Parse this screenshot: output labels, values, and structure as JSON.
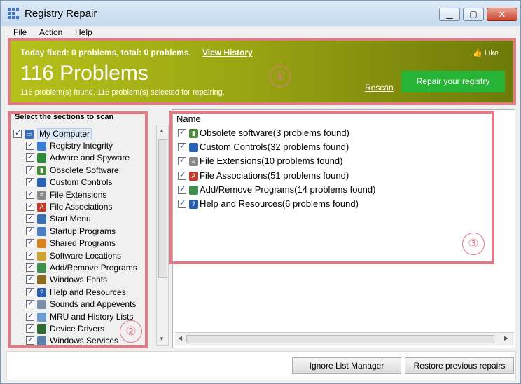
{
  "window": {
    "title": "Registry Repair"
  },
  "menu": [
    "File",
    "Action",
    "Help"
  ],
  "banner": {
    "today": "Today fixed: 0 problems, total: 0 problems.",
    "view_history": "View History",
    "count": "116 Problems",
    "sub": "116 problem(s) found, 116 problem(s) selected for repairing.",
    "rescan": "Rescan",
    "repair": "Repair your registry",
    "like": "Like"
  },
  "annotations": [
    "①",
    "②",
    "③"
  ],
  "sections": {
    "header": "Select the sections to scan",
    "root": "My Computer",
    "items": [
      {
        "label": "Registry Integrity",
        "icon": "registry-icon"
      },
      {
        "label": "Adware and Spyware",
        "icon": "adware-icon"
      },
      {
        "label": "Obsolete Software",
        "icon": "trash-icon"
      },
      {
        "label": "Custom Controls",
        "icon": "controls-icon"
      },
      {
        "label": "File Extensions",
        "icon": "file-icon"
      },
      {
        "label": "File Associations",
        "icon": "file-assoc-icon"
      },
      {
        "label": "Start Menu",
        "icon": "start-menu-icon"
      },
      {
        "label": "Startup Programs",
        "icon": "startup-icon"
      },
      {
        "label": "Shared Programs",
        "icon": "shared-icon"
      },
      {
        "label": "Software Locations",
        "icon": "folder-icon"
      },
      {
        "label": "Add/Remove Programs",
        "icon": "add-remove-icon"
      },
      {
        "label": "Windows Fonts",
        "icon": "fonts-icon"
      },
      {
        "label": "Help and Resources",
        "icon": "help-icon"
      },
      {
        "label": "Sounds and Appevents",
        "icon": "sound-icon"
      },
      {
        "label": "MRU and History Lists",
        "icon": "history-icon"
      },
      {
        "label": "Device Drivers",
        "icon": "driver-icon"
      },
      {
        "label": "Windows Services",
        "icon": "services-icon"
      }
    ]
  },
  "results": {
    "column": "Name",
    "rows": [
      {
        "label": "Obsolete software(3 problems found)",
        "icon": "trash-icon"
      },
      {
        "label": "Custom Controls(32 problems found)",
        "icon": "controls-icon"
      },
      {
        "label": "File Extensions(10 problems found)",
        "icon": "file-icon"
      },
      {
        "label": "File Associations(51 problems found)",
        "icon": "file-assoc-icon"
      },
      {
        "label": "Add/Remove Programs(14 problems found)",
        "icon": "add-remove-icon"
      },
      {
        "label": "Help and Resources(6 problems found)",
        "icon": "help-icon"
      }
    ]
  },
  "buttons": {
    "ignore": "Ignore List Manager",
    "restore": "Restore previous repairs"
  },
  "colors": {
    "banner": "#9aa612",
    "repair": "#27b336",
    "annotation": "#e07b86"
  }
}
